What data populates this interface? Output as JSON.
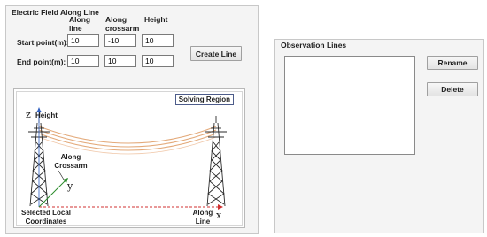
{
  "electric_field": {
    "title": "Electric Field Along Line",
    "columns": [
      "Along line",
      "Along crossarm",
      "Height"
    ],
    "start_label": "Start point(m):",
    "end_label": "End point(m):",
    "start_values": [
      "10",
      "-10",
      "10"
    ],
    "end_values": [
      "10",
      "10",
      "10"
    ],
    "create_button": "Create Line"
  },
  "region": {
    "badge": "Solving Region",
    "z_axis": "z",
    "height_label": "Height",
    "crossarm_label": "Along Crossarm",
    "y_axis": "y",
    "selected_label": "Selected Local Coordinates",
    "along_line_label": "Along Line",
    "x_axis": "x"
  },
  "observation": {
    "title": "Observation Lines",
    "rename_button": "Rename",
    "delete_button": "Delete",
    "items": []
  }
}
